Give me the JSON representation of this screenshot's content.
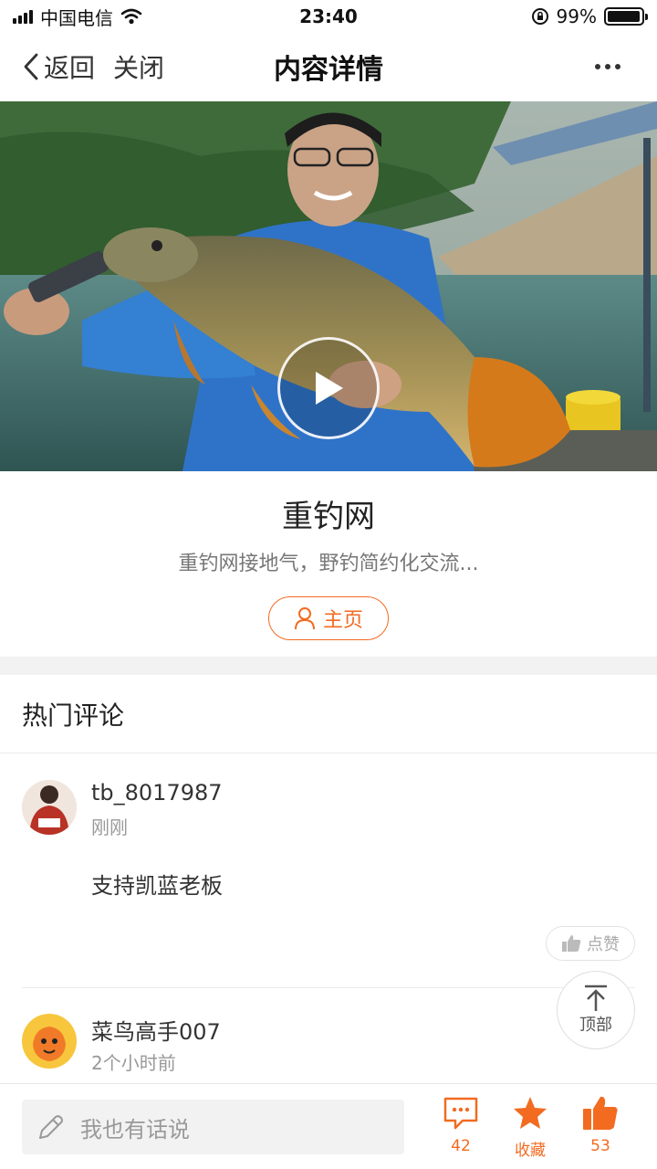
{
  "status_bar": {
    "carrier": "中国电信",
    "time": "23:40",
    "battery_percent": "99%",
    "battery_level": 0.99
  },
  "nav": {
    "back_label": "返回",
    "close_label": "关闭",
    "title": "内容详情",
    "more_icon": "more-dots-icon"
  },
  "hero": {
    "play_icon": "play-icon"
  },
  "author": {
    "name": "重钓网",
    "description": "重钓网接地气，野钓简约化交流...",
    "home_button_label": "主页"
  },
  "comments_section": {
    "title": "热门评论",
    "comments": [
      {
        "user": "tb_8017987",
        "time": "刚刚",
        "text": "支持凯蓝老板",
        "like_label": "点赞"
      },
      {
        "user": "菜鸟高手007",
        "time": "2个小时前"
      }
    ]
  },
  "back_to_top_label": "顶部",
  "bottom_bar": {
    "input_placeholder": "我也有话说",
    "comment_count": "42",
    "favorite_label": "收藏",
    "like_count": "53",
    "accent_color": "#f26b21"
  }
}
